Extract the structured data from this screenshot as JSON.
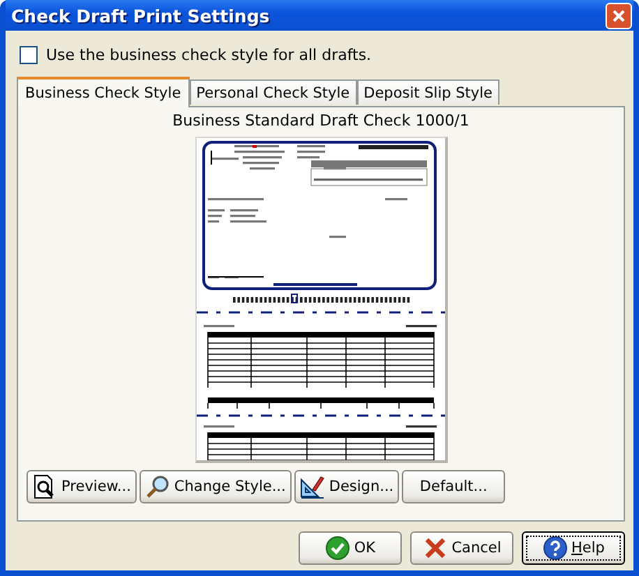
{
  "window": {
    "title": "Check Draft Print Settings"
  },
  "use_business_style": {
    "label": "Use the business check style for all drafts.",
    "checked": false
  },
  "tabs": [
    {
      "label": "Business Check Style",
      "selected": true
    },
    {
      "label": "Personal Check Style",
      "selected": false
    },
    {
      "label": "Deposit Slip Style",
      "selected": false
    }
  ],
  "preview": {
    "caption": "Business Standard Draft Check 1000/1"
  },
  "style_buttons": [
    {
      "label": "Preview...",
      "kind": "preview"
    },
    {
      "label": "Change Style...",
      "kind": "change"
    },
    {
      "label": "Design...",
      "kind": "design"
    },
    {
      "label": "Default...",
      "kind": "none"
    }
  ],
  "dialog_buttons": [
    {
      "label": "OK",
      "kind": "ok",
      "focused": false
    },
    {
      "label": "Cancel",
      "kind": "cancel",
      "focused": false
    },
    {
      "label": "Help",
      "kind": "help",
      "focused": true
    }
  ]
}
